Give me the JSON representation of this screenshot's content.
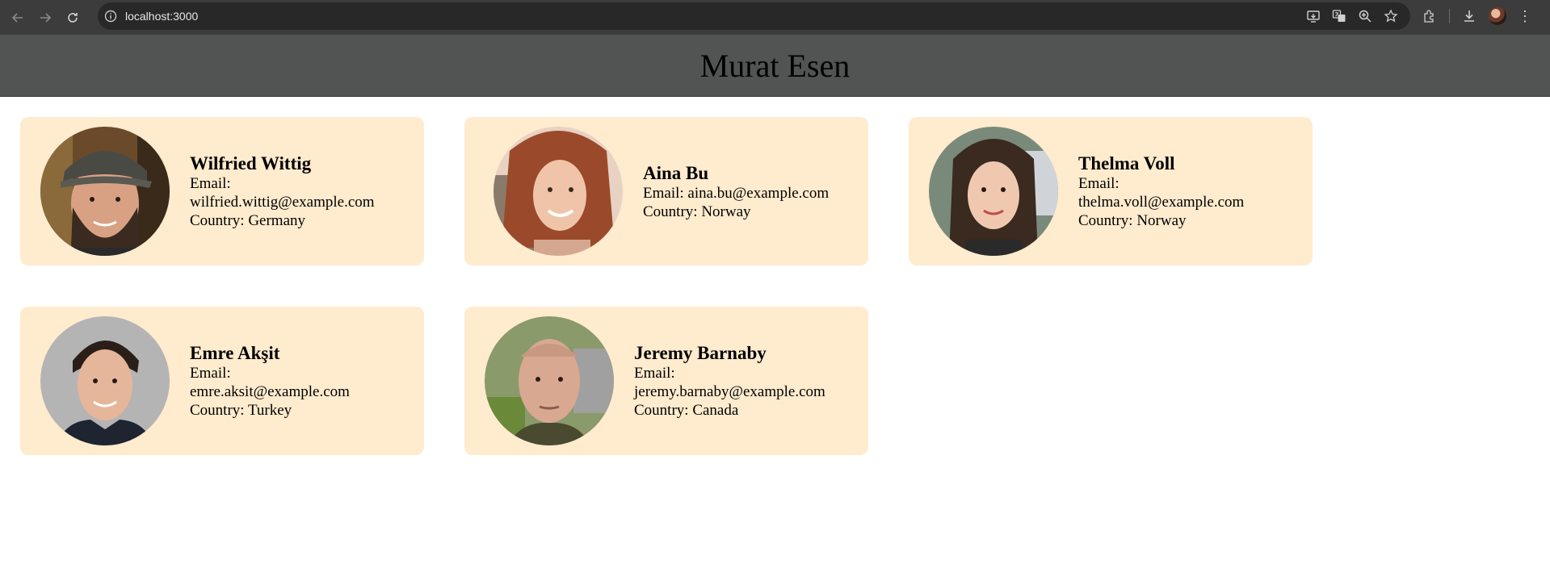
{
  "browser": {
    "url": "localhost:3000"
  },
  "header": {
    "title": "Murat Esen"
  },
  "users": [
    {
      "name": "Wilfried Wittig",
      "email_label": "Email:",
      "email": "wilfried.wittig@example.com",
      "country_label": "Country:",
      "country": "Germany",
      "email_wrap": true
    },
    {
      "name": "Aina Bu",
      "email_label": "Email:",
      "email": "aina.bu@example.com",
      "country_label": "Country:",
      "country": "Norway",
      "email_wrap": false
    },
    {
      "name": "Thelma Voll",
      "email_label": "Email:",
      "email": "thelma.voll@example.com",
      "country_label": "Country:",
      "country": "Norway",
      "email_wrap": true
    },
    {
      "name": "Emre Akşit",
      "email_label": "Email:",
      "email": "emre.aksit@example.com",
      "country_label": "Country:",
      "country": "Turkey",
      "email_wrap": true
    },
    {
      "name": "Jeremy Barnaby",
      "email_label": "Email:",
      "email": "jeremy.barnaby@example.com",
      "country_label": "Country:",
      "country": "Canada",
      "email_wrap": true
    }
  ],
  "colors": {
    "card_bg": "#ffebce",
    "header_bg": "#525454"
  }
}
